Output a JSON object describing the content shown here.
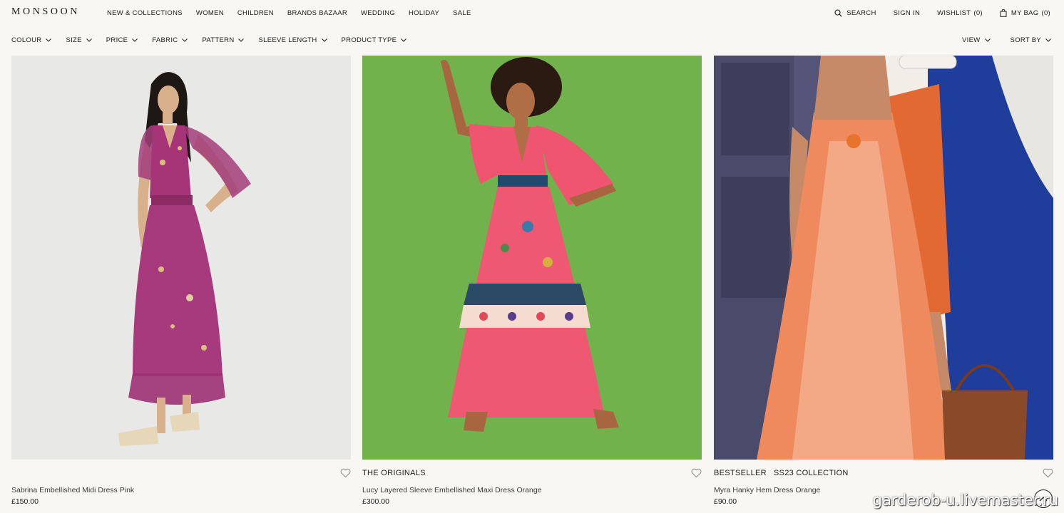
{
  "brand": {
    "logo": "MONSOON"
  },
  "main_nav": [
    "NEW & COLLECTIONS",
    "WOMEN",
    "CHILDREN",
    "BRANDS BAZAAR",
    "WEDDING",
    "HOLIDAY",
    "SALE"
  ],
  "utility_nav": {
    "search": "SEARCH",
    "sign_in": "SIGN IN",
    "wishlist": "WISHLIST",
    "wishlist_count": "(0)",
    "bag": "MY BAG",
    "bag_count": "(0)"
  },
  "filters": [
    "COLOUR",
    "SIZE",
    "PRICE",
    "FABRIC",
    "PATTERN",
    "SLEEVE LENGTH",
    "PRODUCT TYPE"
  ],
  "view_controls": {
    "view": "VIEW",
    "sort": "SORT BY"
  },
  "products": [
    {
      "tags": [],
      "name": "Sabrina Embellished Midi Dress Pink",
      "price": "£150.00"
    },
    {
      "tags": [
        "THE ORIGINALS"
      ],
      "name": "Lucy Layered Sleeve Embellished Maxi Dress Orange",
      "price": "£300.00"
    },
    {
      "tags": [
        "BESTSELLER",
        "SS23 COLLECTION"
      ],
      "name": "Myra Hanky Hem Dress Orange",
      "price": "£90.00"
    }
  ],
  "watermark": "garderob-u.livemaster.ru",
  "colors": {
    "background": "#f8f7f3",
    "text": "#1a1a1a",
    "card1_bg": "#e6e6e4",
    "card2_bg": "#6fb04a"
  }
}
